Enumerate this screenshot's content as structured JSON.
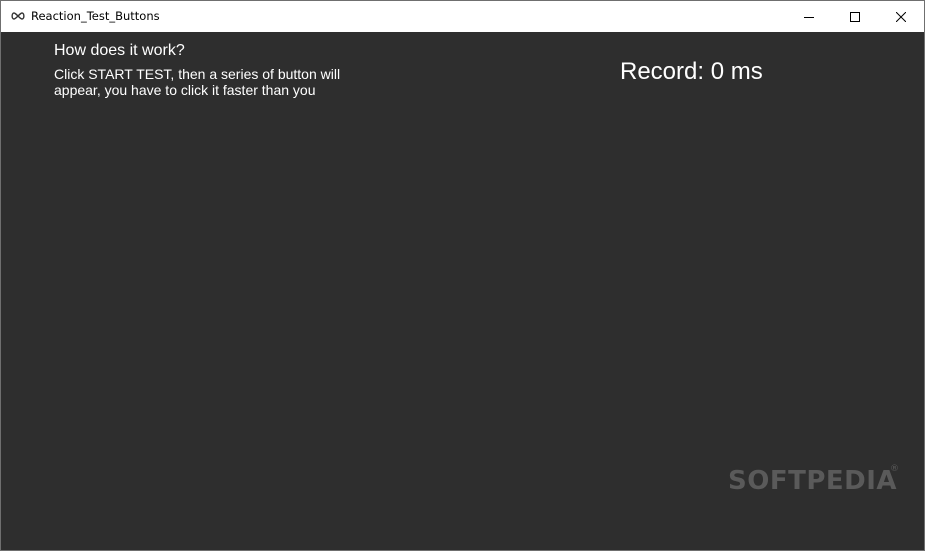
{
  "window": {
    "title": "Reaction_Test_Buttons",
    "icon": "infinity-icon"
  },
  "controls": {
    "minimize_icon": "minimize-icon",
    "maximize_icon": "maximize-icon",
    "close_icon": "close-icon"
  },
  "help": {
    "title": "How does it work?",
    "description": "Click START TEST, then a series of button will appear, you have to click it faster than you"
  },
  "record": {
    "text": "Record: 0 ms"
  },
  "watermark": {
    "text": "SOFTPEDIA",
    "mark": "®"
  },
  "colors": {
    "background": "#2e2e2e",
    "titlebar": "#ffffff",
    "text": "#ffffff",
    "watermark": "#5a5a5a"
  }
}
